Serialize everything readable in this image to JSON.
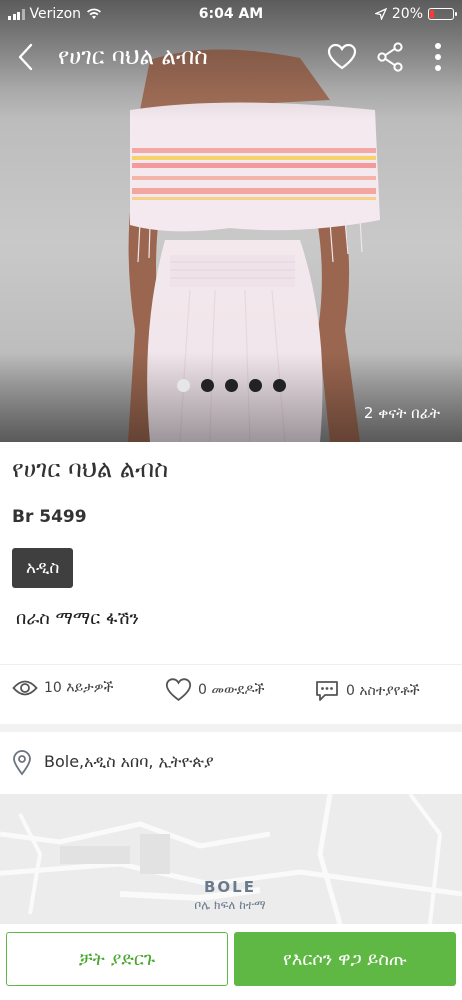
{
  "status_bar": {
    "carrier": "Verizon",
    "time": "6:04 AM",
    "battery": "20%",
    "battery_level": 0.2
  },
  "app_bar": {
    "title": "የሀገር ባህል ልብስ"
  },
  "gallery": {
    "image_count": 5,
    "active_index": 0,
    "posted": "2 ቀናት በፊት"
  },
  "listing": {
    "title": "የሀገር ባህል ልብስ",
    "price": "Br 5499",
    "condition": "አዲስ",
    "seller": "በራስ ማማር ፋሽን"
  },
  "stats": {
    "views": "10 እይታዎች",
    "likes": "0 መውደዶች",
    "comments": "0 አስተያየቶች"
  },
  "location": {
    "text": "Bole,አዲስ አበባ, ኢትዮጵያ"
  },
  "map": {
    "label_en": "BOLE",
    "label_am": "ቦሌ ክፍለ ከተማ"
  },
  "actions": {
    "chat": "ቻት ያድርጉ",
    "offer": "የእርሶን ዋጋ ይስጡ"
  },
  "colors": {
    "accent": "#5fb843",
    "badge": "#3f3f3f",
    "battery_low": "#ff3b30"
  }
}
